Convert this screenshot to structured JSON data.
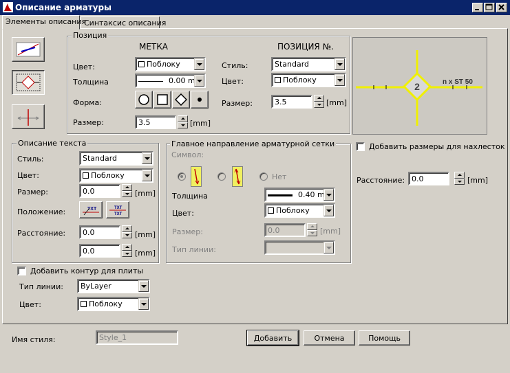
{
  "window": {
    "title": "Описание арматуры"
  },
  "tabs": [
    {
      "label": "Элементы описания"
    },
    {
      "label": "Синтаксис описания"
    }
  ],
  "position": {
    "group_title": "Позиция",
    "marker_header": "МЕТКА",
    "posnum_header": "ПОЗИЦИЯ №.",
    "color_label": "Цвет:",
    "color_value": "Поблоку",
    "thickness_label": "Толщина",
    "thickness_value": "0.00 m",
    "shape_label": "Форма:",
    "size_label": "Размер:",
    "size_value": "3.5",
    "unit": "[mm]",
    "style_label": "Стиль:",
    "style_value": "Standard",
    "num_color_label": "Цвет:",
    "num_color_value": "Поблоку",
    "num_size_label": "Размер:",
    "num_size_value": "3.5",
    "num_unit": "[mm]"
  },
  "preview": {
    "number": "2",
    "label": "n x ST 50"
  },
  "text_desc": {
    "group_title": "Описание текста",
    "style_label": "Стиль:",
    "style_value": "Standard",
    "color_label": "Цвет:",
    "color_value": "Поблоку",
    "size_label": "Размер:",
    "size_value": "0.0",
    "size_unit": "[mm]",
    "position_label": "Положение:",
    "txt_icon": "TXT",
    "distance_label": "Расстояние:",
    "distance_value1": "0.0",
    "distance_unit1": "[mm]",
    "distance_value2": "0.0",
    "distance_unit2": "[mm]"
  },
  "contour": {
    "checkbox_label": "Добавить контур для плиты",
    "linetype_label": "Тип линии:",
    "linetype_value": "ByLayer",
    "color_label": "Цвет:",
    "color_value": "Поблоку"
  },
  "mesh": {
    "group_title": "Главное направление арматурной сетки",
    "symbol_label": "Символ:",
    "none_label": "Нет",
    "thickness_label": "Толщина",
    "thickness_value": "0.40 m",
    "color_label": "Цвет:",
    "color_value": "Поблоку",
    "size_label": "Размер:",
    "size_value": "0.0",
    "size_unit": "[mm]",
    "linetype_label": "Тип линии:"
  },
  "overlap": {
    "checkbox_label": "Добавить размеры для нахлесток",
    "distance_label": "Расстояние:",
    "distance_value": "0.0",
    "distance_unit": "[mm]"
  },
  "footer": {
    "style_name_label": "Имя стиля:",
    "style_name_value": "Style_1",
    "add_label": "Добавить",
    "cancel_label": "Отмена",
    "help_label": "Помощь"
  }
}
